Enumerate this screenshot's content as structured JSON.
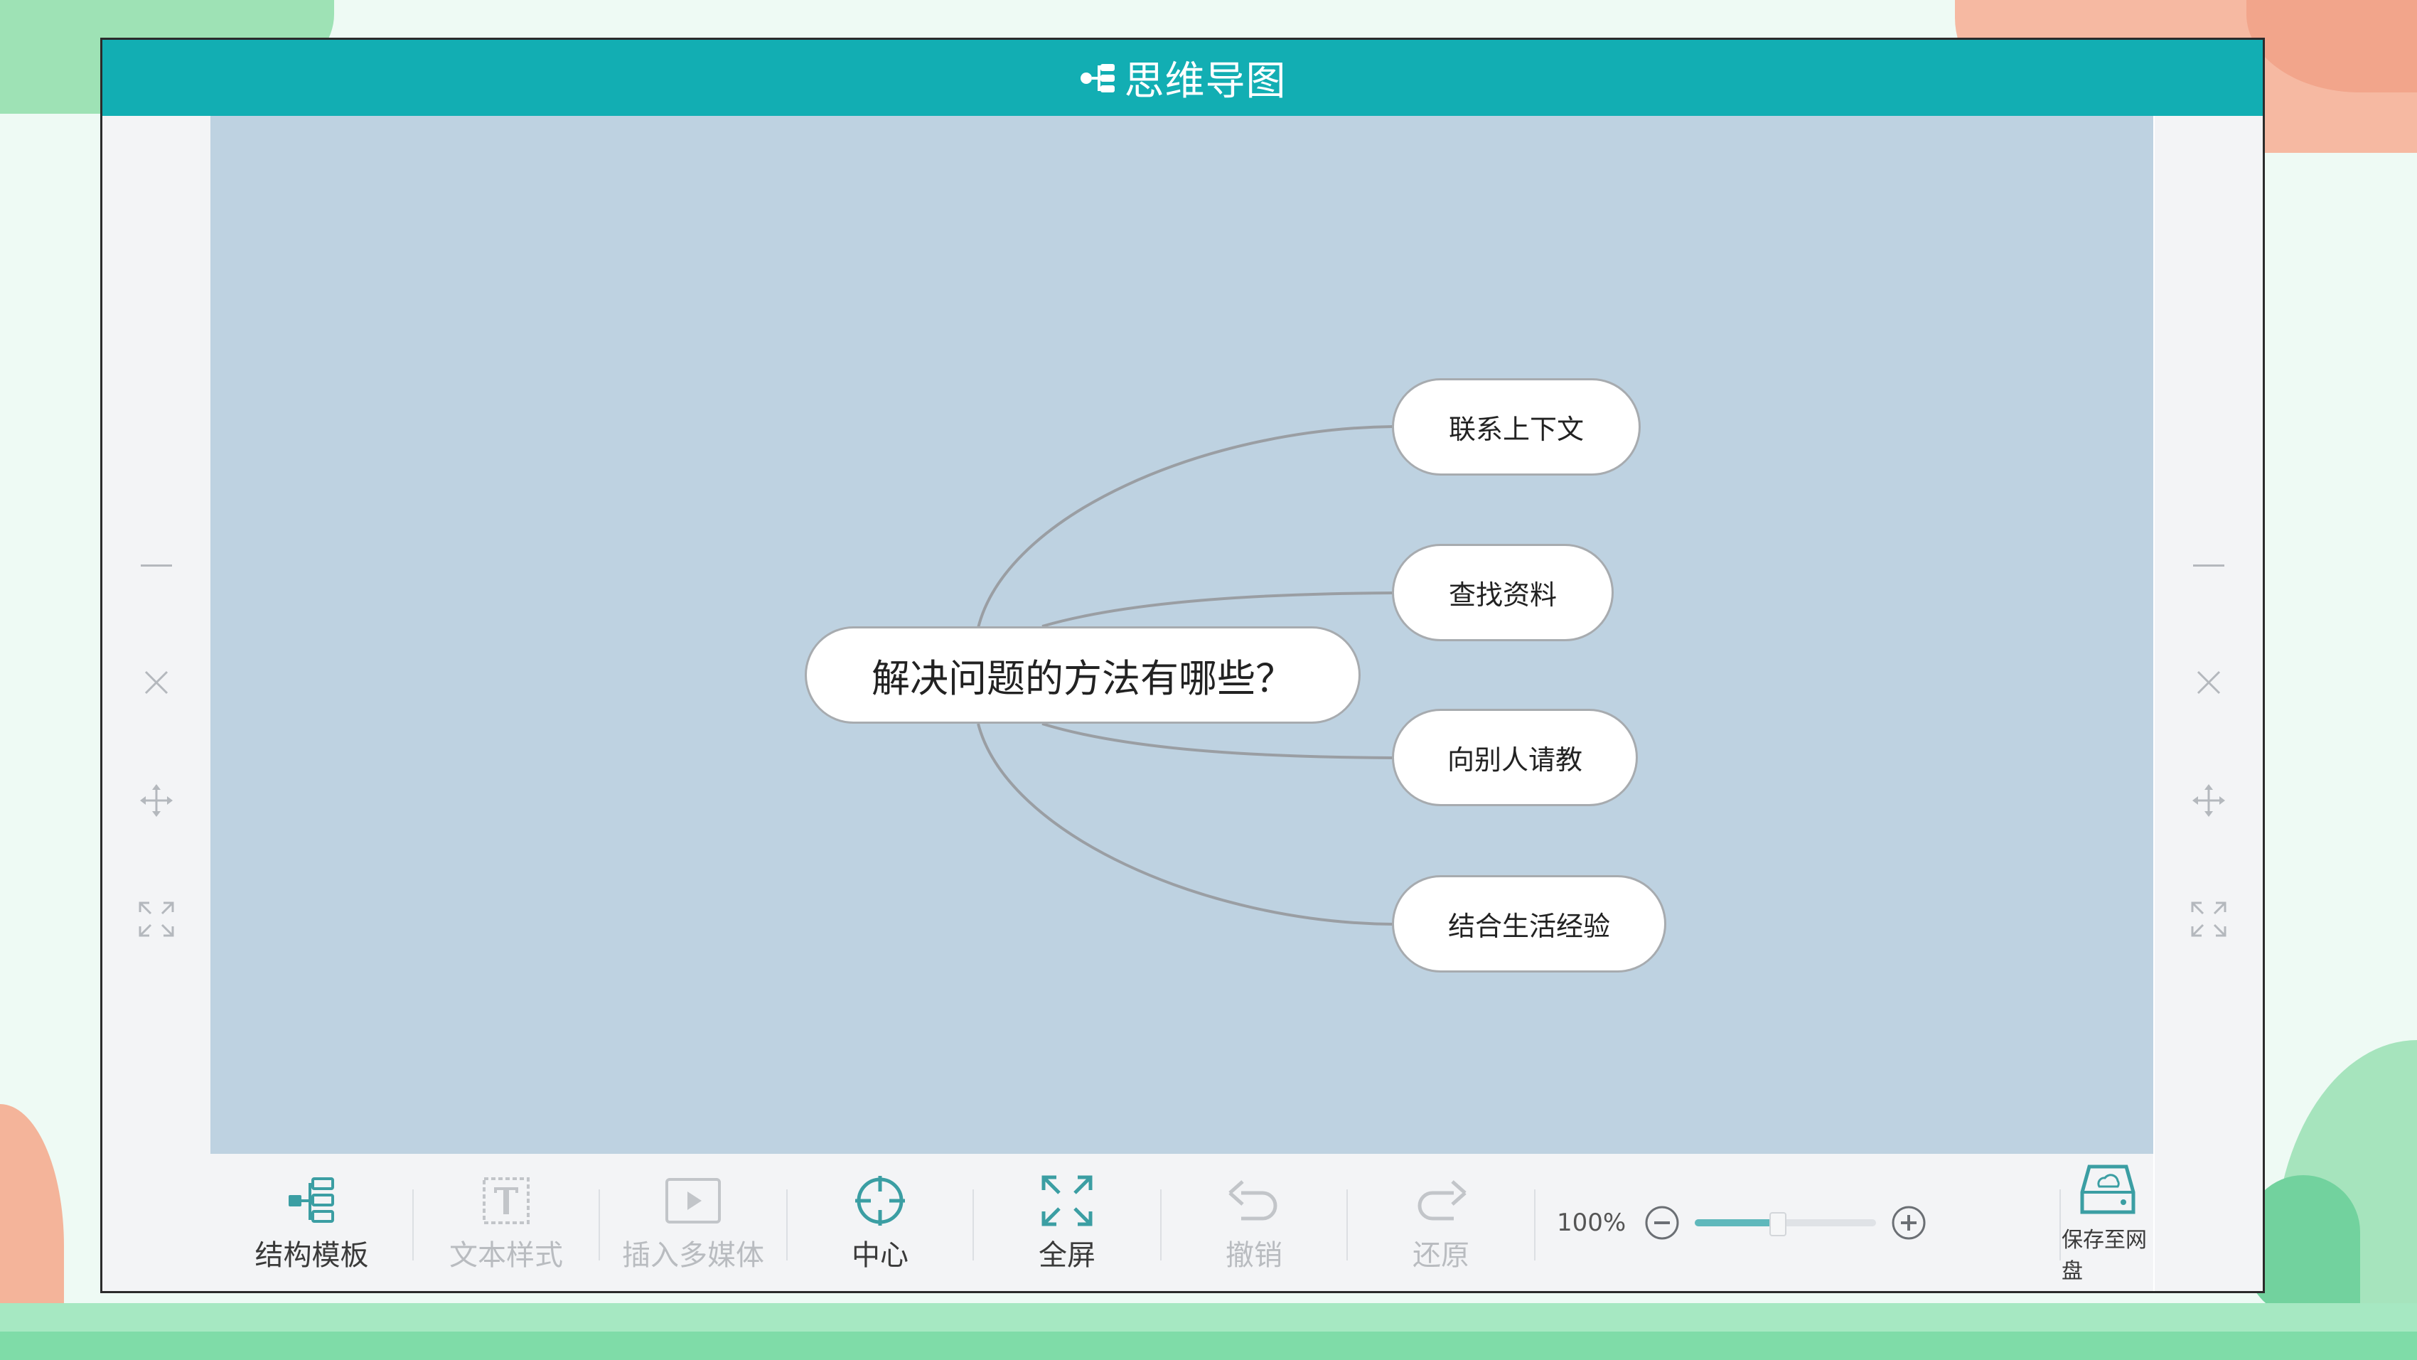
{
  "app": {
    "title": "思维导图"
  },
  "mindmap": {
    "root": "解决问题的方法有哪些？",
    "children": [
      "联系上下文",
      "查找资料",
      "向别人请教",
      "结合生活经验"
    ]
  },
  "toolbar": {
    "items": [
      {
        "label": "结构模板",
        "icon": "structure-template-icon",
        "enabled": true
      },
      {
        "label": "文本样式",
        "icon": "text-style-icon",
        "enabled": false
      },
      {
        "label": "插入多媒体",
        "icon": "insert-media-icon",
        "enabled": false
      },
      {
        "label": "中心",
        "icon": "center-icon",
        "enabled": true
      },
      {
        "label": "全屏",
        "icon": "fullscreen-icon",
        "enabled": true
      },
      {
        "label": "撤销",
        "icon": "undo-icon",
        "enabled": false
      },
      {
        "label": "还原",
        "icon": "redo-icon",
        "enabled": false
      }
    ],
    "zoom": {
      "label": "100%",
      "level": 0.45
    },
    "save_label": "保存至网盘"
  },
  "colors": {
    "titlebar": "#12aeb3",
    "canvas": "#bed2e1",
    "toolbar": "#f3f4f6",
    "accent": "#3b9ea3"
  },
  "side_tools": [
    "minimize-icon",
    "close-icon",
    "move-icon",
    "expand-icon"
  ]
}
